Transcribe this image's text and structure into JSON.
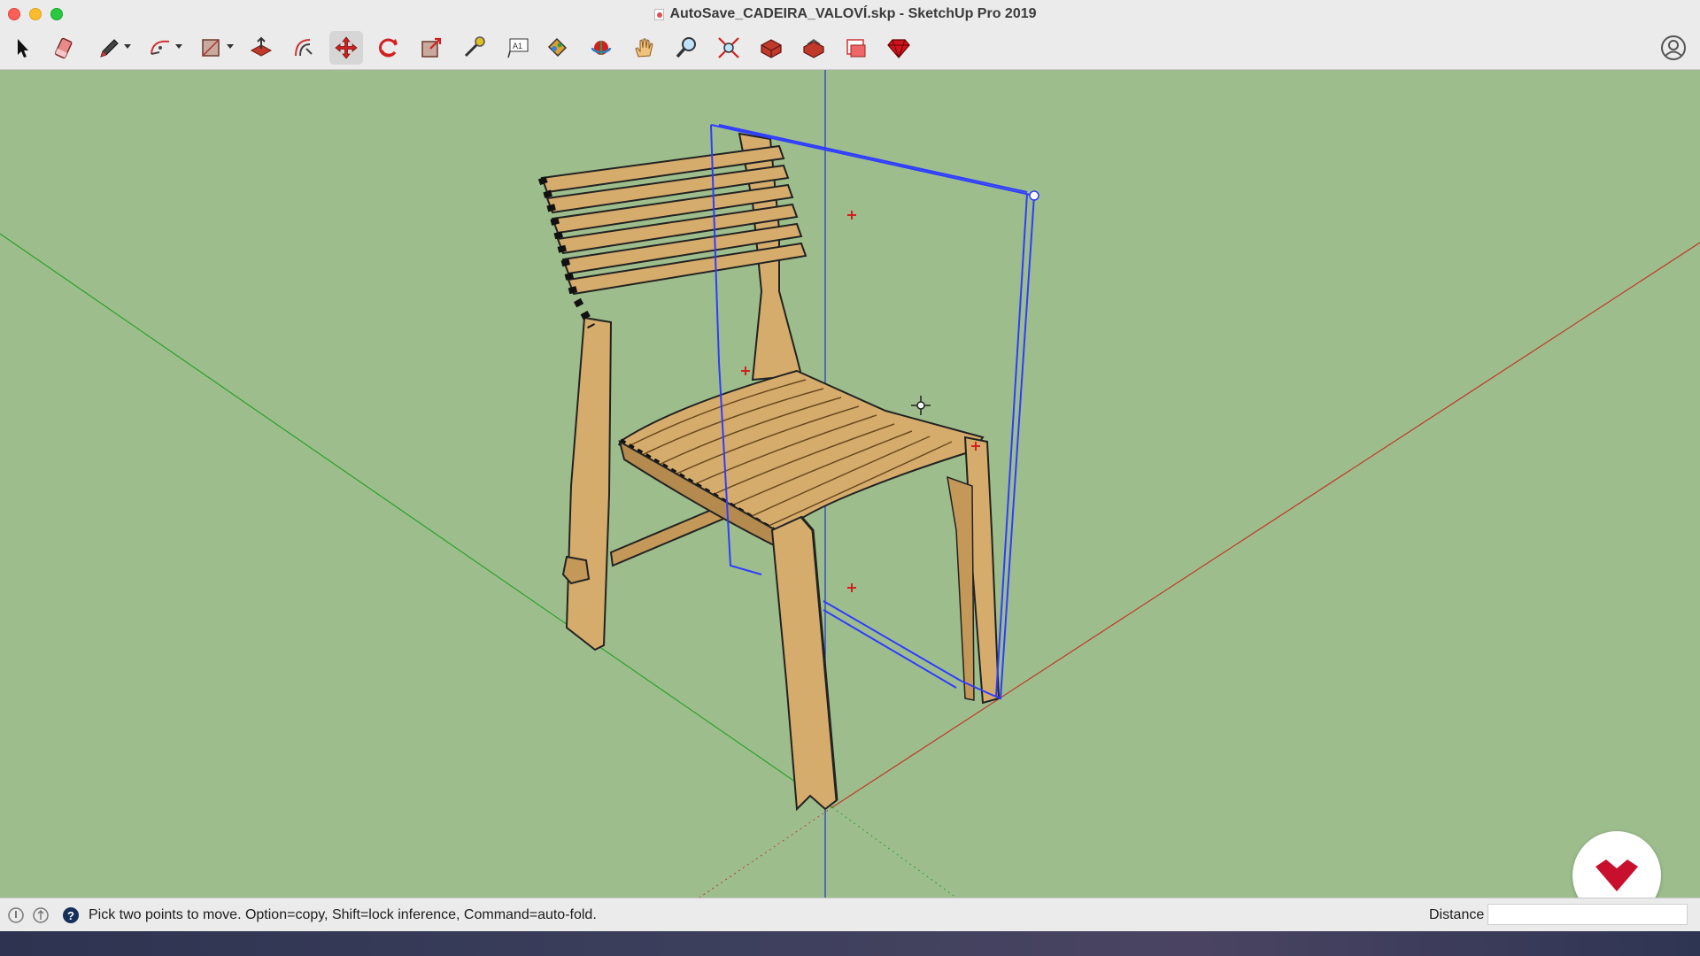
{
  "window": {
    "title": "AutoSave_CADEIRA_VALOVÍ.skp - SketchUp Pro 2019"
  },
  "toolbar": {
    "tools": [
      {
        "name": "select",
        "icon": "arrow-select-icon",
        "active": false
      },
      {
        "name": "eraser",
        "icon": "eraser-icon",
        "active": false
      },
      {
        "name": "line",
        "icon": "pencil-icon",
        "active": false
      },
      {
        "name": "arc",
        "icon": "arc-icon",
        "active": false
      },
      {
        "name": "shape",
        "icon": "rectangle-icon",
        "active": false
      },
      {
        "name": "push-pull",
        "icon": "push-pull-icon",
        "active": false
      },
      {
        "name": "offset",
        "icon": "offset-icon",
        "active": false
      },
      {
        "name": "move",
        "icon": "move-icon",
        "active": true
      },
      {
        "name": "rotate",
        "icon": "rotate-icon",
        "active": false
      },
      {
        "name": "scale",
        "icon": "scale-icon",
        "active": false
      },
      {
        "name": "tape-measure",
        "icon": "tape-measure-icon",
        "active": false
      },
      {
        "name": "text",
        "icon": "text-icon",
        "active": false
      },
      {
        "name": "paint-bucket",
        "icon": "paint-bucket-icon",
        "active": false
      },
      {
        "name": "orbit",
        "icon": "orbit-icon",
        "active": false
      },
      {
        "name": "pan",
        "icon": "pan-hand-icon",
        "active": false
      },
      {
        "name": "zoom",
        "icon": "zoom-icon",
        "active": false
      },
      {
        "name": "zoom-extents",
        "icon": "zoom-extents-icon",
        "active": false
      },
      {
        "name": "3d-warehouse",
        "icon": "warehouse-icon",
        "active": false
      },
      {
        "name": "extension-warehouse",
        "icon": "extension-warehouse-icon",
        "active": false
      },
      {
        "name": "layout",
        "icon": "layout-icon",
        "active": false
      },
      {
        "name": "ruby",
        "icon": "ruby-gem-icon",
        "active": false
      }
    ]
  },
  "status": {
    "prompt": "Pick two points to move.  Option=copy, Shift=lock inference, Command=auto-fold.",
    "measurement_label": "Distance",
    "measurement_value": ""
  },
  "colors": {
    "viewport_bg": "#9dbe8c",
    "selection_blue": "#2f3cff",
    "wood": "#d6ac6c",
    "wood_dark": "#b48a4e",
    "axis_red": "#c0392b",
    "axis_green": "#2ca02c",
    "axis_blue": "#2233cc",
    "logo_red": "#c8102e"
  }
}
